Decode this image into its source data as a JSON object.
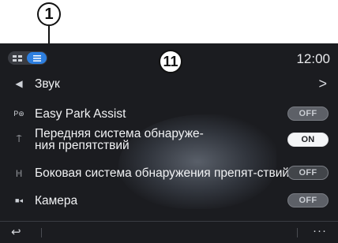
{
  "callout_number": "1",
  "badge_number": "11",
  "status": {
    "clock": "12:00"
  },
  "topbar": {
    "grid_icon": "grid-icon",
    "list_icon": "list-icon"
  },
  "settings": [
    {
      "icon": "speaker-icon",
      "icon_glyph": "◀",
      "label": "Звук",
      "control": "chevron",
      "glyph": ">"
    },
    {
      "icon": "park-assist-icon",
      "icon_glyph": "P⊛",
      "label": "Easy Park Assist",
      "control": "switch",
      "state": "OFF"
    },
    {
      "icon": "front-sensor-icon",
      "icon_glyph": "⍑",
      "label": "Передняя система обнаруже-ния препятствий",
      "control": "switch",
      "state": "ON"
    },
    {
      "icon": "side-sensor-icon",
      "icon_glyph": "|▫|",
      "label": "Боковая система обнаружения препят-ствий",
      "control": "switch",
      "state": "OFF"
    },
    {
      "icon": "camera-icon",
      "icon_glyph": "■◂",
      "label": "Камера",
      "control": "switch",
      "state": "OFF"
    }
  ],
  "bottombar": {
    "back_glyph": "↩",
    "more_glyph": "···"
  }
}
